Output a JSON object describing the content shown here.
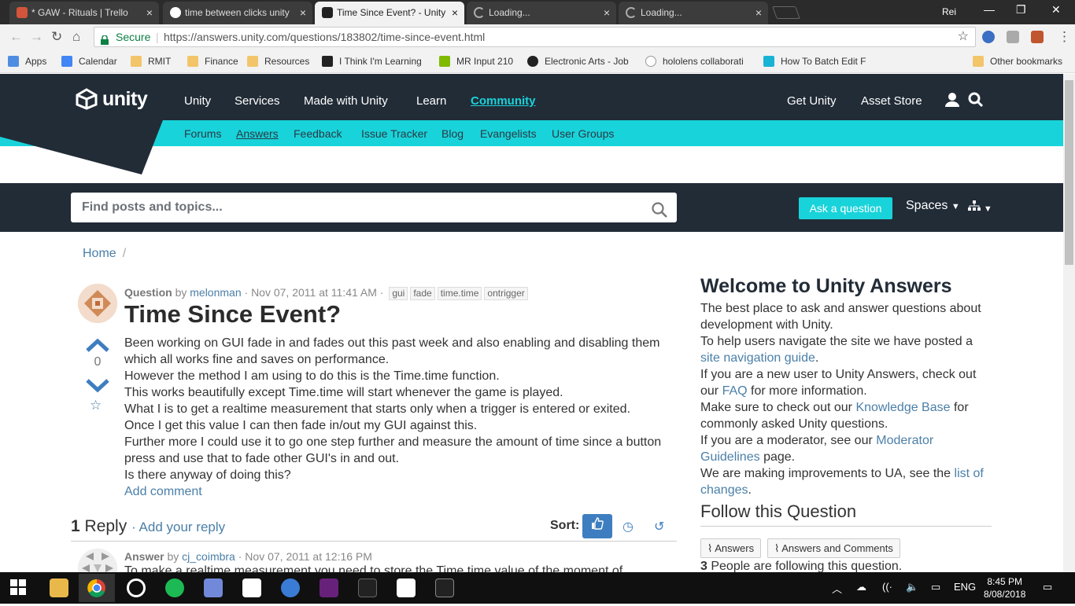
{
  "browser": {
    "tabs": [
      {
        "title": "* GAW - Rituals | Trello",
        "fav": "trello-icon"
      },
      {
        "title": "time between clicks unity",
        "fav": "google-icon"
      },
      {
        "title": "Time Since Event? - Unity",
        "fav": "unity-icon"
      },
      {
        "title": "Loading...",
        "fav": "loading-icon"
      },
      {
        "title": "Loading...",
        "fav": "loading-icon"
      }
    ],
    "profile": "Rei",
    "secure_label": "Secure",
    "url": "https://answers.unity.com/questions/183802/time-since-event.html",
    "bookmarks": [
      {
        "label": "Apps"
      },
      {
        "label": "Calendar"
      },
      {
        "label": "RMIT"
      },
      {
        "label": "Finance"
      },
      {
        "label": "Resources"
      },
      {
        "label": "I Think I'm Learning"
      },
      {
        "label": "MR Input 210"
      },
      {
        "label": "Electronic Arts - Job"
      },
      {
        "label": "hololens collaborati"
      },
      {
        "label": "How To Batch Edit F"
      },
      {
        "label": "Other bookmarks"
      }
    ]
  },
  "header": {
    "logo": "unity",
    "nav": [
      "Unity",
      "Services",
      "Made with Unity",
      "Learn",
      "Community"
    ],
    "right": [
      "Get Unity",
      "Asset Store"
    ],
    "subnav": [
      "Forums",
      "Answers",
      "Feedback",
      "Issue Tracker",
      "Blog",
      "Evangelists",
      "User Groups"
    ]
  },
  "search": {
    "placeholder": "Find posts and topics...",
    "ask_label": "Ask a question",
    "spaces_label": "Spaces"
  },
  "breadcrumb": {
    "home": "Home",
    "sep": "/"
  },
  "question": {
    "label": "Question",
    "by": "by",
    "author": "melonman",
    "date": "· Nov 07, 2011 at 11:41 AM ·",
    "tags": [
      "gui",
      "fade",
      "time.time",
      "ontrigger"
    ],
    "title": "Time Since Event?",
    "votes": "0",
    "body": [
      "Been working on GUI fade in and fades out this past week and also enabling and disabling them which all works fine and saves on performance.",
      "However the method I am using to do this is the Time.time function.",
      "This works beautifully except Time.time will start whenever the game is played.",
      "What I is to get a realtime measurement that starts only when a trigger is entered or exited.",
      "Once I get this value I can then fade in/out my GUI against this.",
      "Further more I could use it to go one step further and measure the amount of time since a button press and use that to fade other GUI's in and out.",
      "Is there anyway of doing this?"
    ],
    "add_comment": "Add comment"
  },
  "replies": {
    "count": "1",
    "label": "Reply",
    "add_reply": "· Add your reply",
    "sort_label": "Sort:"
  },
  "answer": {
    "label": "Answer",
    "by": "by",
    "author": "cj_coimbra",
    "date": "· Nov 07, 2011 at 12:16 PM",
    "body_start": "To make a realtime measurement you need to store the Time.time value of the moment of"
  },
  "sidebar": {
    "title": "Welcome to Unity Answers",
    "p1": "The best place to ask and answer questions about development with Unity.",
    "p2_text": "To help users navigate the site we have posted a",
    "p2_link": "site navigation guide",
    "p2_end": ".",
    "p3_text": "If you are a new user to Unity Answers, check out our",
    "p3_link": "FAQ",
    "p3_end": "for more information.",
    "p4_text": "Make sure to check out our",
    "p4_link": "Knowledge Base",
    "p4_end": "for commonly asked Unity questions.",
    "p5_text": "If you are a moderator, see our",
    "p5_link": "Moderator Guidelines",
    "p5_end": "page.",
    "p6_text": "We are making improvements to UA, see the",
    "p6_link": "list of changes",
    "p6_end": ".",
    "follow_title": "Follow this Question",
    "follow_btn1": "Answers",
    "follow_btn2": "Answers and Comments",
    "following_count": "3",
    "following_text": "People are following this question."
  },
  "taskbar": {
    "lang": "ENG",
    "time": "8:45 PM",
    "date": "8/08/2018"
  },
  "colors": {
    "unity_dark": "#222c37",
    "unity_cyan": "#19d3da",
    "link": "#4a7fa8"
  }
}
